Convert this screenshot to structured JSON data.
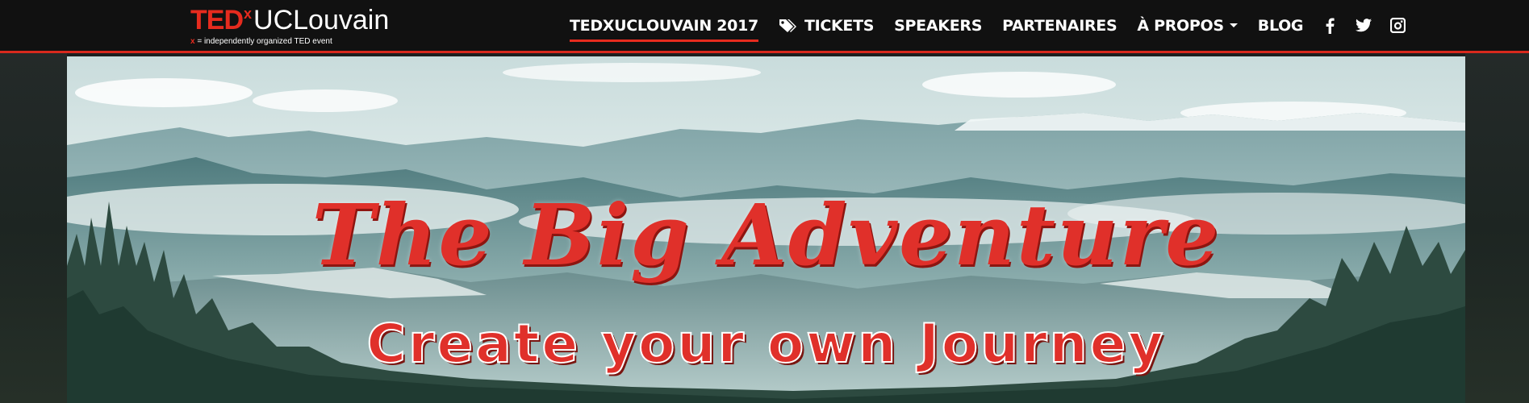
{
  "brand": {
    "ted": "TED",
    "x": "x",
    "name": "UCLouvain",
    "tagline_x": "x",
    "tagline_rest": " = independently organized TED event"
  },
  "nav": {
    "items": [
      {
        "label": "TEDXUCLOUVAIN 2017",
        "active": true
      },
      {
        "label": "TICKETS",
        "icon": "tag-icon"
      },
      {
        "label": "SPEAKERS"
      },
      {
        "label": "PARTENAIRES"
      },
      {
        "label": "À PROPOS",
        "dropdown": true
      },
      {
        "label": "BLOG"
      }
    ],
    "social": [
      "facebook-icon",
      "twitter-icon",
      "instagram-icon"
    ]
  },
  "hero": {
    "title": "The Big Adventure",
    "subtitle": "Create your own Journey"
  },
  "colors": {
    "accent": "#e62b1e",
    "navbar_bg": "#111111"
  }
}
